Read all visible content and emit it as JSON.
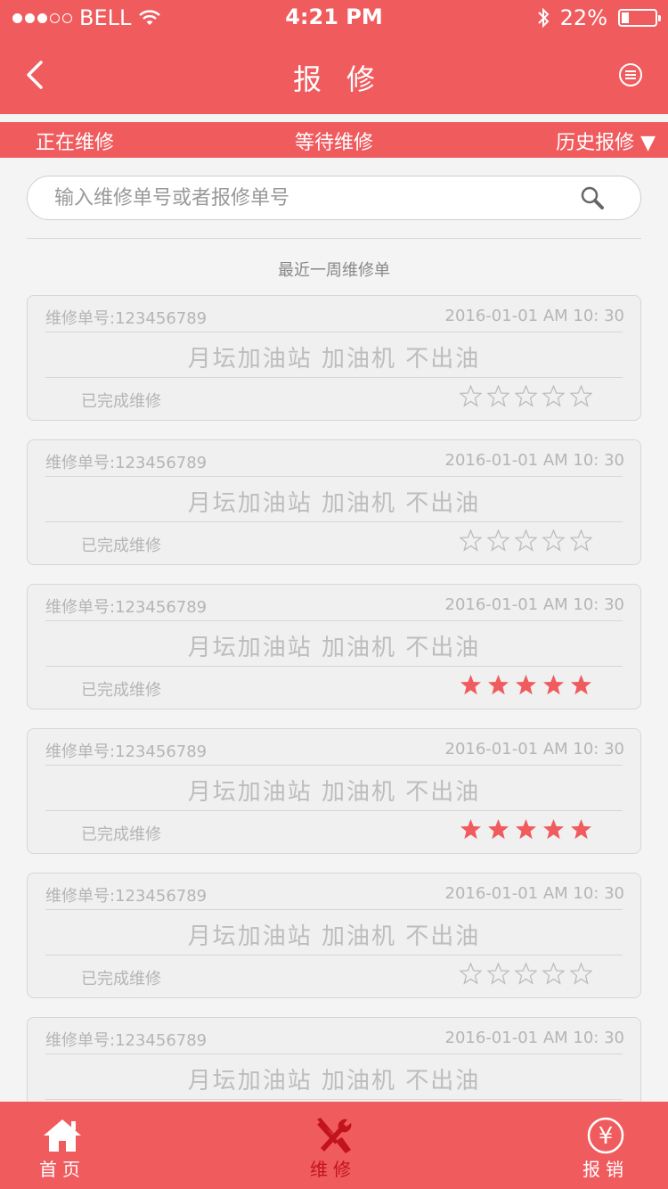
{
  "status_bar": {
    "carrier": "BELL",
    "time": "4:21 PM",
    "battery_percent": "22%",
    "battery_level": 0.22
  },
  "nav": {
    "title": "报修",
    "back_icon": "chevron-left-icon",
    "menu_icon": "list-circle-icon"
  },
  "tabs": {
    "ongoing": "正在维修",
    "waiting": "等待维修",
    "history": "历史报修 ▼"
  },
  "search": {
    "placeholder": "输入维修单号或者报修单号",
    "icon": "search-icon"
  },
  "section_title": "最近一周维修单",
  "orders": [
    {
      "order_no": "维修单号:123456789",
      "time": "2016-01-01 AM 10: 30",
      "description": "月坛加油站 加油机 不出油",
      "status": "已完成维修",
      "rating": 0
    },
    {
      "order_no": "维修单号:123456789",
      "time": "2016-01-01 AM 10: 30",
      "description": "月坛加油站 加油机 不出油",
      "status": "已完成维修",
      "rating": 0
    },
    {
      "order_no": "维修单号:123456789",
      "time": "2016-01-01 AM 10: 30",
      "description": "月坛加油站 加油机 不出油",
      "status": "已完成维修",
      "rating": 5
    },
    {
      "order_no": "维修单号:123456789",
      "time": "2016-01-01 AM 10: 30",
      "description": "月坛加油站 加油机 不出油",
      "status": "已完成维修",
      "rating": 5
    },
    {
      "order_no": "维修单号:123456789",
      "time": "2016-01-01 AM 10: 30",
      "description": "月坛加油站 加油机 不出油",
      "status": "已完成维修",
      "rating": 0
    },
    {
      "order_no": "维修单号:123456789",
      "time": "2016-01-01 AM 10: 30",
      "description": "月坛加油站 加油机 不出油",
      "status": "",
      "rating": null
    }
  ],
  "tab_bar": {
    "home": "首页",
    "repair": "维修",
    "expense": "报销"
  },
  "colors": {
    "brand": "#f05b5e",
    "star_active": "#f05b5e",
    "repair_active": "#c2131a"
  }
}
